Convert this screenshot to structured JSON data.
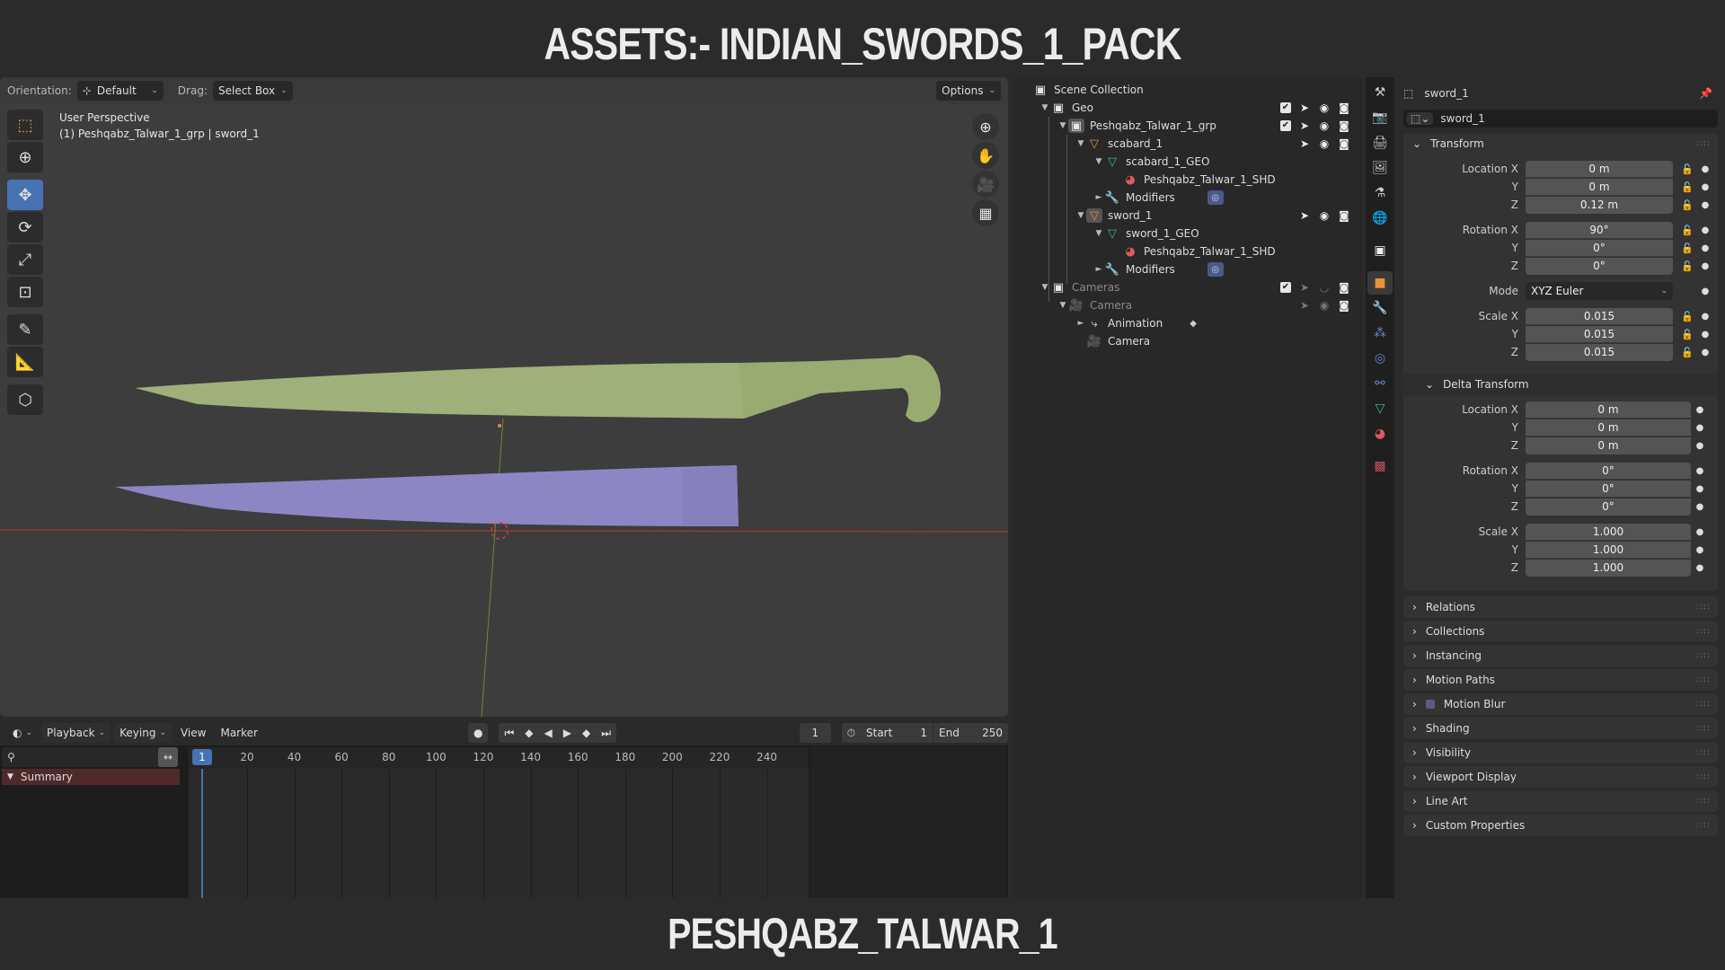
{
  "banner": {
    "top_title": "ASSETS:- INDIAN_SWORDS_1_PACK",
    "bottom_title": "PESHQABZ_TALWAR_1"
  },
  "viewport": {
    "orientation_label": "Orientation:",
    "orientation_value": "Default",
    "drag_label": "Drag:",
    "drag_value": "Select Box",
    "options_label": "Options",
    "info_line1": "User Perspective",
    "info_line2": "(1) Peshqabz_Talwar_1_grp | sword_1",
    "tools": [
      {
        "name": "select-box-tool",
        "icon": "select-box-icon",
        "active": false
      },
      {
        "name": "cursor-tool",
        "icon": "cursor-icon",
        "active": false
      },
      {
        "name": "move-tool",
        "icon": "move-icon",
        "active": true
      },
      {
        "name": "rotate-tool",
        "icon": "rotate-icon",
        "active": false
      },
      {
        "name": "scale-tool",
        "icon": "scale-icon",
        "active": false
      },
      {
        "name": "transform-tool",
        "icon": "transform-icon",
        "active": false
      },
      {
        "name": "annotate-tool",
        "icon": "annotate-icon",
        "active": false
      },
      {
        "name": "measure-tool",
        "icon": "measure-icon",
        "active": false
      },
      {
        "name": "add-cube-tool",
        "icon": "add-cube-icon",
        "active": false
      }
    ],
    "nav_gizmos": [
      "zoom-icon",
      "pan-hand-icon",
      "camera-view-icon",
      "ortho-grid-icon"
    ],
    "objects": [
      {
        "name": "sword_1",
        "color": "#9fb07a"
      },
      {
        "name": "scabard_1",
        "color": "#8c87c4"
      }
    ]
  },
  "timeline": {
    "editor_icon": "clock-icon",
    "menus": [
      "Playback",
      "Keying",
      "View",
      "Marker"
    ],
    "current_frame": "1",
    "start_label": "Start",
    "start_value": "1",
    "end_label": "End",
    "end_value": "250",
    "summary_label": "Summary",
    "ticks": [
      "20",
      "40",
      "60",
      "80",
      "100",
      "120",
      "140",
      "160",
      "180",
      "200",
      "220",
      "240"
    ],
    "playhead_label": "1"
  },
  "outliner": {
    "rows": [
      {
        "label": "Scene Collection",
        "indent": 0,
        "tri": "",
        "icon": "collection-icon",
        "right": []
      },
      {
        "label": "Geo",
        "indent": 1,
        "tri": "▼",
        "icon": "collection-icon",
        "right": [
          "check",
          "select",
          "eye",
          "render"
        ]
      },
      {
        "label": "Peshqabz_Talwar_1_grp",
        "indent": 2,
        "tri": "▼",
        "icon": "collection-icon",
        "right": [
          "check",
          "select",
          "eye",
          "render"
        ]
      },
      {
        "label": "scabard_1",
        "indent": 3,
        "tri": "▼",
        "icon": "object-icon",
        "right": [
          "select",
          "eye",
          "render"
        ]
      },
      {
        "label": "scabard_1_GEO",
        "indent": 4,
        "tri": "▼",
        "icon": "mesh-icon",
        "right": []
      },
      {
        "label": "Peshqabz_Talwar_1_SHD",
        "indent": 5,
        "tri": "",
        "icon": "material-icon",
        "right": []
      },
      {
        "label": "Modifiers",
        "indent": 4,
        "tri": "►",
        "icon": "wrench-icon",
        "right": [],
        "badge": true
      },
      {
        "label": "sword_1",
        "indent": 3,
        "tri": "▼",
        "icon": "object-icon",
        "right": [
          "select",
          "eye",
          "render"
        ]
      },
      {
        "label": "sword_1_GEO",
        "indent": 4,
        "tri": "▼",
        "icon": "mesh-icon",
        "right": []
      },
      {
        "label": "Peshqabz_Talwar_1_SHD",
        "indent": 5,
        "tri": "",
        "icon": "material-icon",
        "right": []
      },
      {
        "label": "Modifiers",
        "indent": 4,
        "tri": "►",
        "icon": "wrench-icon",
        "right": [],
        "badge": true
      },
      {
        "label": "Cameras",
        "indent": 1,
        "tri": "▼",
        "icon": "collection-icon",
        "right": [
          "check",
          "select-dim",
          "eye-closed",
          "render"
        ],
        "dim": true
      },
      {
        "label": "Camera",
        "indent": 2,
        "tri": "▼",
        "icon": "camera-object-icon",
        "right": [
          "select-dim",
          "eye-dim",
          "render"
        ],
        "dim": true
      },
      {
        "label": "Animation",
        "indent": 3,
        "tri": "►",
        "icon": "animation-icon",
        "right": [],
        "keyframe": true
      },
      {
        "label": "Camera",
        "indent": 3,
        "tri": "",
        "icon": "camera-data-icon",
        "right": []
      }
    ]
  },
  "properties": {
    "tabs": [
      "tool-icon",
      "render-icon",
      "output-icon",
      "view-layer-icon",
      "scene-icon",
      "world-icon",
      "collection-icon",
      "object-icon",
      "modifier-icon",
      "particles-icon",
      "physics-icon",
      "constraints-icon",
      "data-icon",
      "material-icon",
      "texture-icon"
    ],
    "active_tab": "object-icon",
    "header_name": "sword_1",
    "object_name": "sword_1",
    "transform": {
      "title": "Transform",
      "location": {
        "label": "Location X",
        "x": "0 m",
        "y": "0 m",
        "z": "0.12 m"
      },
      "rotation": {
        "label": "Rotation X",
        "x": "90°",
        "y": "0°",
        "z": "0°"
      },
      "mode_label": "Mode",
      "mode_value": "XYZ Euler",
      "scale": {
        "label": "Scale X",
        "x": "0.015",
        "y": "0.015",
        "z": "0.015"
      },
      "axis_y": "Y",
      "axis_z": "Z"
    },
    "delta": {
      "title": "Delta Transform",
      "location": {
        "label": "Location X",
        "x": "0 m",
        "y": "0 m",
        "z": "0 m"
      },
      "rotation": {
        "label": "Rotation X",
        "x": "0°",
        "y": "0°",
        "z": "0°"
      },
      "scale": {
        "label": "Scale X",
        "x": "1.000",
        "y": "1.000",
        "z": "1.000"
      }
    },
    "collapsed_panels": [
      "Relations",
      "Collections",
      "Instancing",
      "Motion Paths",
      "Motion Blur",
      "Shading",
      "Visibility",
      "Viewport Display",
      "Line Art",
      "Custom Properties"
    ]
  }
}
